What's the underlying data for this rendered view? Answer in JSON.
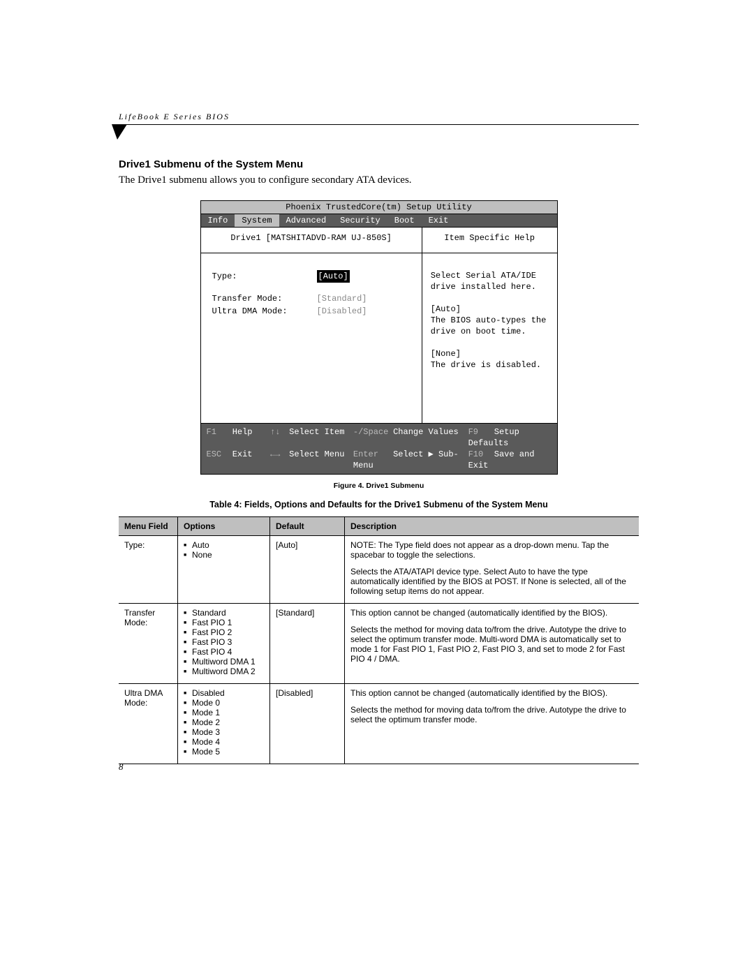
{
  "header": "LifeBook E Series BIOS",
  "section_title": "Drive1 Submenu of the System Menu",
  "intro": "The Drive1 submenu allows you to configure secondary ATA devices.",
  "bios": {
    "title": "Phoenix TrustedCore(tm) Setup Utility",
    "tabs": [
      "Info",
      "System",
      "Advanced",
      "Security",
      "Boot",
      "Exit"
    ],
    "active_tab": "System",
    "left_title": "Drive1 [MATSHITADVD-RAM UJ-850S]",
    "rows": [
      {
        "label": "Type:",
        "value": "[Auto]",
        "style": "highlight"
      },
      {
        "label": "Transfer Mode:",
        "value": "[Standard]",
        "style": "gray"
      },
      {
        "label": "Ultra DMA Mode:",
        "value": "[Disabled]",
        "style": "gray"
      }
    ],
    "help_title": "Item Specific Help",
    "help_lines": [
      "Select Serial ATA/IDE",
      "drive installed here.",
      "",
      "[Auto]",
      "The BIOS auto-types the",
      "drive on boot time.",
      "",
      "[None]",
      "The drive is disabled."
    ],
    "footer": [
      [
        {
          "k": "F1",
          "t": "Help"
        },
        {
          "a": "↑↓",
          "t": "Select Item"
        },
        {
          "k": "-/Space",
          "t": "Change Values"
        },
        {
          "k": "F9",
          "t": "Setup Defaults"
        }
      ],
      [
        {
          "k": "ESC",
          "t": "Exit"
        },
        {
          "a": "←→",
          "t": "Select Menu"
        },
        {
          "k": "Enter",
          "t": "Select ▶ Sub-Menu"
        },
        {
          "k": "F10",
          "t": "Save and Exit"
        }
      ]
    ]
  },
  "figure_caption": "Figure 4.  Drive1 Submenu",
  "table_caption": "Table 4: Fields, Options and Defaults for the Drive1 Submenu of the System Menu",
  "table": {
    "headers": [
      "Menu Field",
      "Options",
      "Default",
      "Description"
    ],
    "rows": [
      {
        "field": "Type:",
        "options": [
          "Auto",
          "None"
        ],
        "default": "[Auto]",
        "description": [
          "NOTE: The Type field does not appear as a drop-down menu. Tap the spacebar to toggle the selections.",
          "Selects the ATA/ATAPI device type. Select Auto to have the type automatically identified by the BIOS at POST. If None is selected, all of the following setup items do not appear."
        ]
      },
      {
        "field": "Transfer Mode:",
        "options": [
          "Standard",
          "Fast PIO 1",
          "Fast PIO 2",
          "Fast PIO 3",
          "Fast PIO 4",
          "Multiword DMA 1",
          "Multiword DMA 2"
        ],
        "default": "[Standard]",
        "description": [
          "This option cannot be changed (automatically identified by the BIOS).",
          "Selects the method for moving data to/from the drive. Autotype the drive to select the optimum transfer mode.  Multi-word DMA is automatically set to mode 1 for Fast PIO 1, Fast PIO 2, Fast PIO 3, and set to mode 2 for Fast PIO 4 / DMA."
        ]
      },
      {
        "field": "Ultra DMA Mode:",
        "options": [
          "Disabled",
          "Mode 0",
          "Mode 1",
          "Mode 2",
          "Mode 3",
          "Mode 4",
          "Mode 5"
        ],
        "default": "[Disabled]",
        "description": [
          "This option cannot be changed (automatically identified by the BIOS).",
          "Selects the method for moving data to/from the drive. Autotype the drive to select the optimum transfer mode."
        ]
      }
    ]
  },
  "page_number": "8"
}
